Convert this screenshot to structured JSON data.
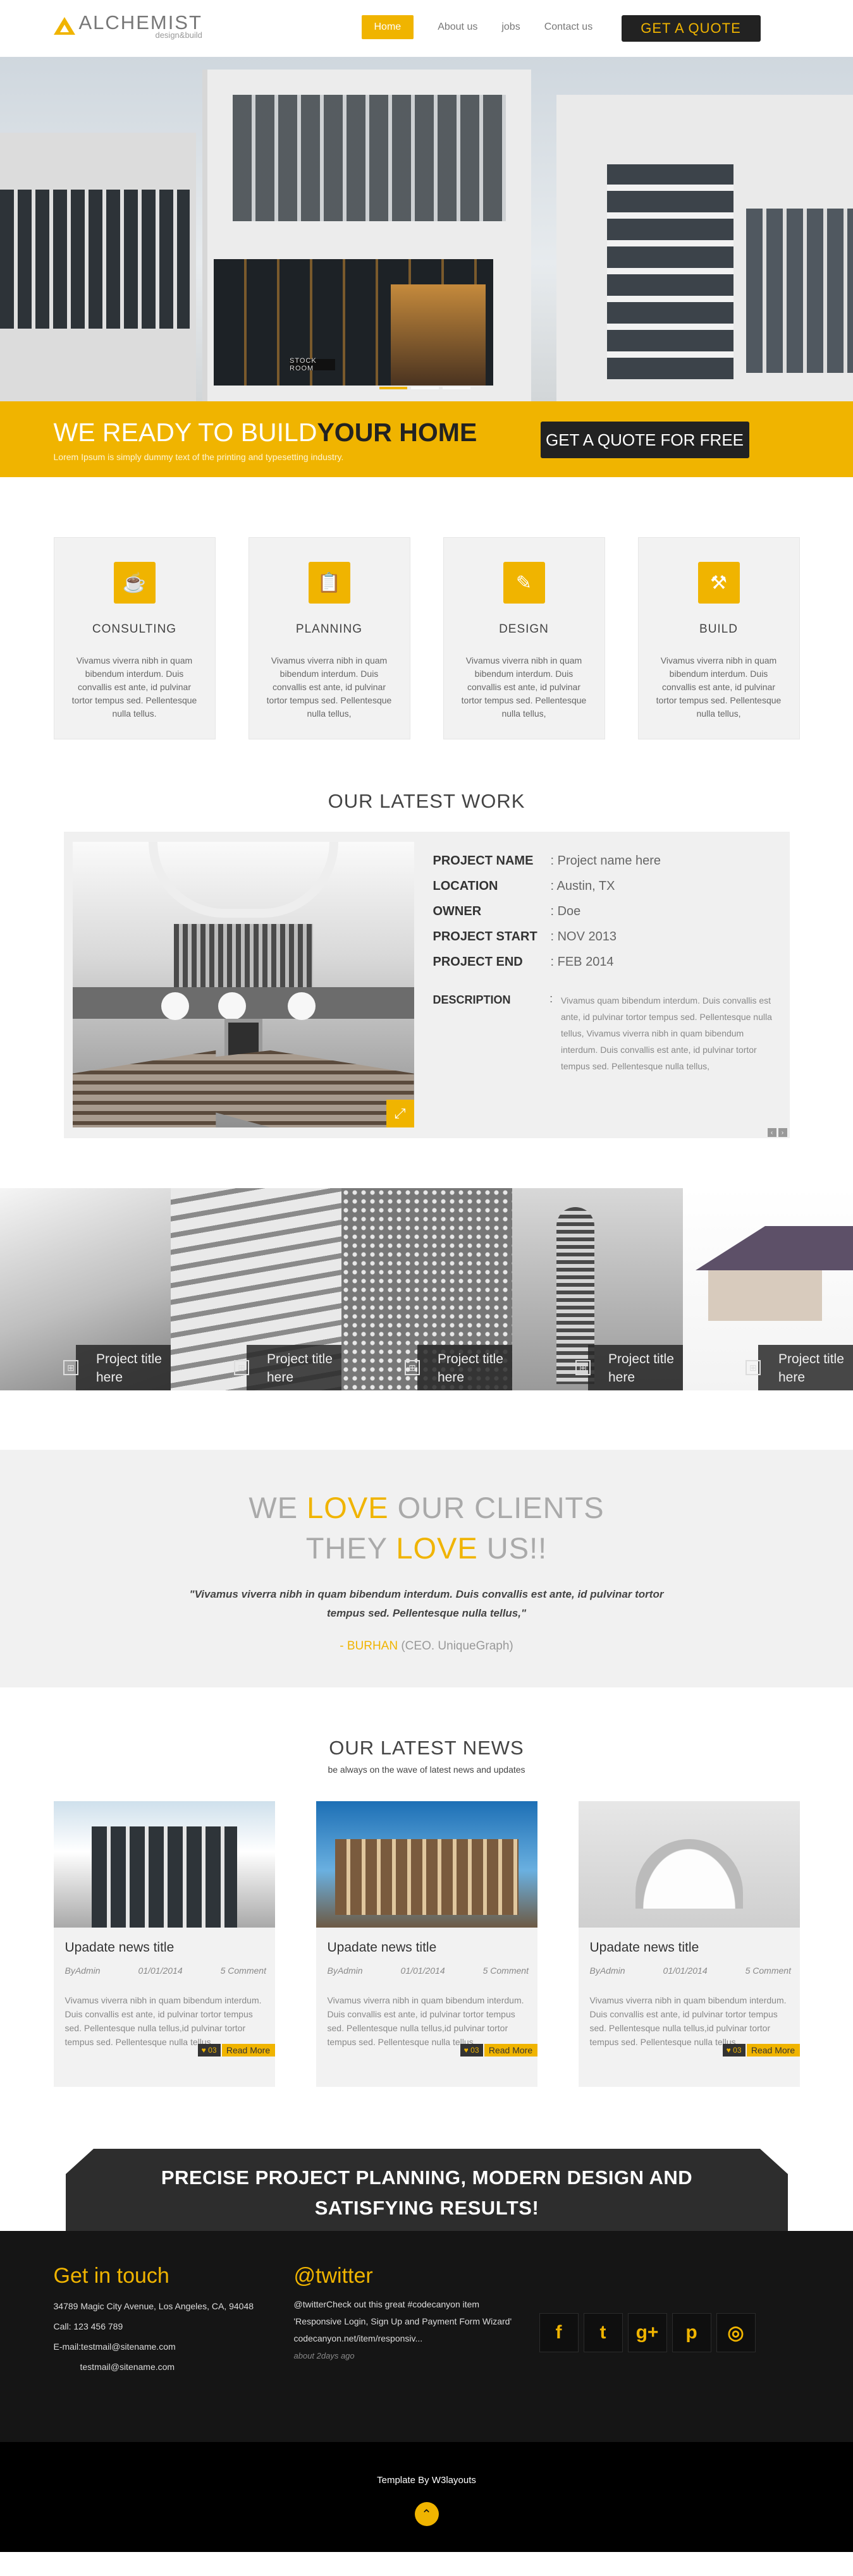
{
  "header": {
    "logo_title": "ALCHEMIST",
    "logo_sub": "design&build",
    "nav": [
      {
        "label": "Home",
        "active": true
      },
      {
        "label": "About us"
      },
      {
        "label": "jobs"
      },
      {
        "label": "Contact us"
      }
    ],
    "quote_button": "GET A QUOTE"
  },
  "hero": {
    "sign": "STOCK ROOM",
    "slides": 3,
    "active_slide": 1
  },
  "cta": {
    "title_light": "WE READY TO BUILD",
    "title_bold": "YOUR HOME",
    "subtitle": "Lorem Ipsum is simply dummy text of the printing and typesetting industry.",
    "button": "GET A QUOTE FOR FREE"
  },
  "services": [
    {
      "icon": "cup-icon",
      "title": "CONSULTING",
      "text": "Vivamus viverra nibh in quam bibendum interdum. Duis convallis est ante, id pulvinar tortor tempus sed. Pellentesque nulla tellus."
    },
    {
      "icon": "clipboard-icon",
      "title": "PLANNING",
      "text": "Vivamus viverra nibh in quam bibendum interdum. Duis convallis est ante, id pulvinar tortor tempus sed. Pellentesque nulla tellus,"
    },
    {
      "icon": "pencil-square-icon",
      "title": "DESIGN",
      "text": "Vivamus viverra nibh in quam bibendum interdum. Duis convallis est ante, id pulvinar tortor tempus sed. Pellentesque nulla tellus,"
    },
    {
      "icon": "tools-icon",
      "title": "BUILD",
      "text": "Vivamus viverra nibh in quam bibendum interdum. Duis convallis est ante, id pulvinar tortor tempus sed. Pellentesque nulla tellus,"
    }
  ],
  "work": {
    "title": "OUR LATEST WORK",
    "rows": [
      {
        "key": "PROJECT NAME",
        "value": ": Project name here"
      },
      {
        "key": "LOCATION",
        "value": ": Austin, TX"
      },
      {
        "key": "OWNER",
        "value": ": Doe"
      },
      {
        "key": "PROJECT START",
        "value": ": NOV 2013"
      },
      {
        "key": "PROJECT END",
        "value": ": FEB 2014"
      }
    ],
    "description_key": "DESCRIPTION",
    "description_colon": ":",
    "description": "Vivamus quam bibendum interdum. Duis convallis est ante, id pulvinar tortor tempus sed. Pellentesque nulla tellus, Vivamus viverra nibh in quam bibendum interdum. Duis convallis est ante, id pulvinar tortor tempus sed. Pellentesque nulla tellus,",
    "prev": "‹",
    "next": "›"
  },
  "projects": [
    {
      "caption": "Project title here"
    },
    {
      "caption": "Project title here"
    },
    {
      "caption": "Project title here"
    },
    {
      "caption": "Project title here"
    },
    {
      "caption": "Project title here"
    }
  ],
  "testimonial": {
    "line1_a": "WE ",
    "line1_hl": "LOVE",
    "line1_b": " OUR CLIENTS",
    "line2_a": "THEY ",
    "line2_hl": "LOVE",
    "line2_b": " US!!",
    "quote": "\"Vivamus viverra nibh in quam bibendum interdum. Duis convallis est ante, id pulvinar tortor tempus sed. Pellentesque nulla tellus,\"",
    "author_prefix": "- ",
    "author_name": "BURHAN",
    "author_role": " (CEO. UniqueGraph)"
  },
  "news": {
    "title": "OUR LATEST NEWS",
    "subtitle": "be always on the wave of latest news and updates",
    "items": [
      {
        "title": "Upadate news title",
        "by": "ByAdmin",
        "date": "01/01/2014",
        "comments": "5 Comment",
        "text": "Vivamus viverra nibh in quam bibendum interdum. Duis convallis est ante, id pulvinar tortor tempus sed. Pellentesque nulla tellus,id pulvinar tortor tempus sed. Pellentesque nulla tellus,",
        "likes": "03",
        "read_more": "Read More"
      },
      {
        "title": "Upadate news title",
        "by": "ByAdmin",
        "date": "01/01/2014",
        "comments": "5 Comment",
        "text": "Vivamus viverra nibh in quam bibendum interdum. Duis convallis est ante, id pulvinar tortor tempus sed. Pellentesque nulla tellus,id pulvinar tortor tempus sed. Pellentesque nulla tellus,",
        "likes": "03",
        "read_more": "Read More"
      },
      {
        "title": "Upadate news title",
        "by": "ByAdmin",
        "date": "01/01/2014",
        "comments": "5 Comment",
        "text": "Vivamus viverra nibh in quam bibendum interdum. Duis convallis est ante, id pulvinar tortor tempus sed. Pellentesque nulla tellus,id pulvinar tortor tempus sed. Pellentesque nulla tellus,",
        "likes": "03",
        "read_more": "Read More"
      }
    ]
  },
  "tagline": {
    "line1": "PRECISE PROJECT PLANNING, MODERN DESIGN AND",
    "line2": "SATISFYING RESULTS!"
  },
  "footer": {
    "contact_title": "Get in touch",
    "address": "34789 Magic City Avenue, Los Angeles, CA, 94048",
    "phone": "Call: 123 456 789",
    "email1": "E-mail:testmail@sitename.com",
    "email2": "testmail@sitename.com",
    "twitter_title": "@twitter",
    "tweet": "@twitterCheck out this great #codecanyon item 'Responsive Login, Sign Up and Payment Form Wizard' codecanyon.net/item/responsiv...",
    "tweet_time": "about 2days ago",
    "socials": [
      {
        "icon": "facebook-icon",
        "glyph": "f"
      },
      {
        "icon": "twitter-icon",
        "glyph": "t"
      },
      {
        "icon": "google-plus-icon",
        "glyph": "g+"
      },
      {
        "icon": "pinterest-icon",
        "glyph": "p"
      },
      {
        "icon": "dribbble-icon",
        "glyph": "◎"
      }
    ]
  },
  "bottom": {
    "credit": "Template By W3layouts",
    "to_top": "⌃"
  },
  "colors": {
    "accent": "#f0b400",
    "dark": "#222222",
    "footer_bg": "#151515"
  }
}
